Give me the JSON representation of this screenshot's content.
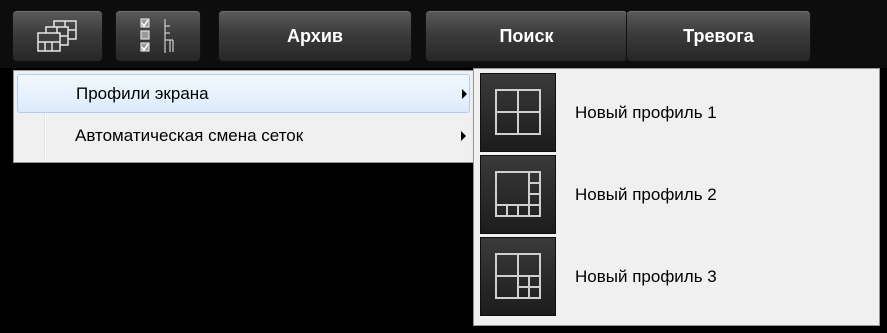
{
  "toolbar": {
    "layout_icon": "screen-layouts-icon",
    "checklist_icon": "checklist-tree-icon",
    "archive_label": "Архив",
    "search_label": "Поиск",
    "alarm_label": "Тревога"
  },
  "menu": {
    "items": [
      {
        "label": "Профили экрана",
        "highlighted": true,
        "has_submenu": true
      },
      {
        "label": "Автоматическая смена сеток",
        "highlighted": false,
        "has_submenu": true
      }
    ]
  },
  "submenu": {
    "items": [
      {
        "label": "Новый профиль 1",
        "icon": "grid-2x2-icon"
      },
      {
        "label": "Новый профиль 2",
        "icon": "grid-1plus7-icon"
      },
      {
        "label": "Новый профиль 3",
        "icon": "grid-3plus4-icon"
      }
    ]
  },
  "colors": {
    "toolbar_bg": "#0d0d0d",
    "button_top": "#5a5a5a",
    "button_bottom": "#262626",
    "menu_bg": "#f0f0f0",
    "highlight": "#dcebfb"
  }
}
